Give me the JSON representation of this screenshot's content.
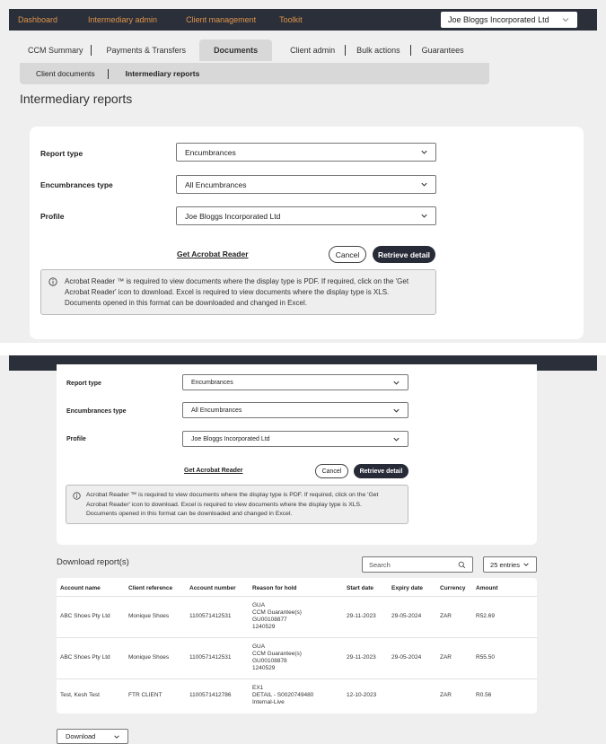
{
  "topnav": {
    "items": [
      "Dashboard",
      "Intermediary admin",
      "Client management",
      "Toolkit"
    ],
    "client_selector": "Joe Bloggs Incorporated Ltd"
  },
  "tabs": [
    "CCM Summary",
    "Payments & Transfers",
    "Documents",
    "Client admin",
    "Bulk actions",
    "Guarantees"
  ],
  "active_tab": "Documents",
  "subtabs": [
    "Client documents",
    "Intermediary reports"
  ],
  "active_subtab": "Intermediary reports",
  "page_title": "Intermediary reports",
  "form": {
    "report_type_label": "Report type",
    "report_type_value": "Encumbrances",
    "encumbrances_type_label": "Encumbrances type",
    "encumbrances_type_value": "All Encumbrances",
    "profile_label": "Profile",
    "profile_value": "Joe Bloggs Incorporated Ltd",
    "acrobat_link": "Get Acrobat Reader",
    "cancel_label": "Cancel",
    "retrieve_label": "Retrieve detail",
    "info_lines": [
      "Acrobat Reader ™ is required to view documents where the display type is PDF. If required, click on the 'Get",
      "Acrobat Reader' icon to download. Excel is required to view documents where the display type is XLS.",
      "Documents opened in this format can be downloaded and changed in Excel."
    ]
  },
  "download": {
    "title": "Download report(s)",
    "search_placeholder": "Search",
    "entries_label": "25 entries",
    "columns": [
      "Account name",
      "Client reference",
      "Account number",
      "Reason for hold",
      "Start date",
      "Expiry date",
      "Currency",
      "Amount"
    ],
    "rows": [
      {
        "account_name": "ABC Shoes Pty Ltd",
        "client_reference": "Monique Shoes",
        "account_number": "1100571412531",
        "reason": [
          "GUA",
          "CCM Guarantee(s)",
          "GU00108877",
          "1240529"
        ],
        "start_date": "29-11-2023",
        "expiry_date": "29-05-2024",
        "currency": "ZAR",
        "amount": "R52.69"
      },
      {
        "account_name": "ABC Shoes Pty Ltd",
        "client_reference": "Monique Shoes",
        "account_number": "1100571412531",
        "reason": [
          "GUA",
          "CCM Guarantee(s)",
          "GU00108878",
          "1240529"
        ],
        "start_date": "29-11-2023",
        "expiry_date": "29-05-2024",
        "currency": "ZAR",
        "amount": "R55.50"
      },
      {
        "account_name": "Test, Kesh Test",
        "client_reference": "FTR CLIENT",
        "account_number": "1100571412786",
        "reason": [
          "EX1",
          "DETAIL - S0020749480",
          "Internal-Live"
        ],
        "start_date": "12-10-2023",
        "expiry_date": "",
        "currency": "ZAR",
        "amount": "R0.56"
      }
    ],
    "download_label": "Download"
  }
}
